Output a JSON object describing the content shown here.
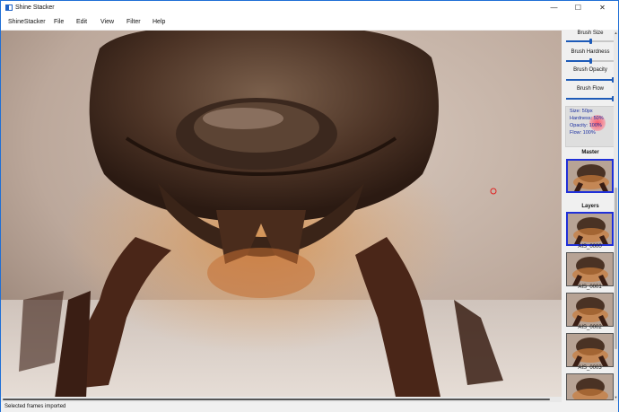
{
  "window": {
    "title": "Shine Stacker",
    "controls": {
      "minimize": "—",
      "maximize": "☐",
      "close": "✕"
    }
  },
  "menubar": {
    "items": [
      "ShineStacker",
      "File",
      "Edit",
      "View",
      "Filter",
      "Help"
    ]
  },
  "sidebar": {
    "brush_controls": [
      {
        "label": "Brush Size",
        "value_fraction": 0.5
      },
      {
        "label": "Brush Hardness",
        "value_fraction": 0.5
      },
      {
        "label": "Brush Opacity",
        "value_fraction": 1.0
      },
      {
        "label": "Brush Flow",
        "value_fraction": 1.0
      }
    ],
    "brush_info": {
      "size": "Size: 50px",
      "hardness": "Hardness: 50%",
      "opacity": "Opacity: 100%",
      "flow": "Flow: 100%"
    },
    "master_label": "Master",
    "layers_label": "Layers",
    "layers": [
      "AIS_0000",
      "AIS_0001",
      "AIS_0002",
      "AIS_0003"
    ]
  },
  "status": {
    "text": "Selected frames imported"
  },
  "colors": {
    "accent": "#1e5bb8",
    "selection": "#2030d8",
    "cursor": "#e02020"
  }
}
